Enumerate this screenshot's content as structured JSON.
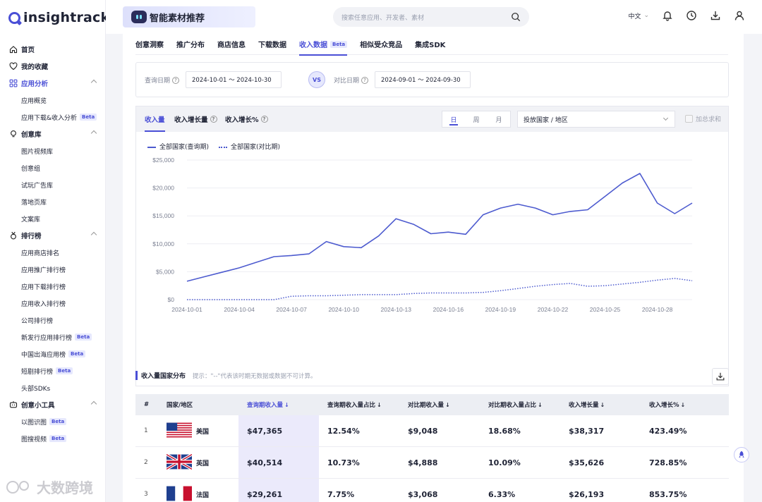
{
  "brand": {
    "name": "insightrackr",
    "accent": "#4a4fd6"
  },
  "header": {
    "banner": "智能素材推荐",
    "search_placeholder": "搜索任意应用、开发者、素材",
    "lang": "中文"
  },
  "sidebar": {
    "items": [
      {
        "label": "首页",
        "icon": "home-icon",
        "type": "item"
      },
      {
        "label": "我的收藏",
        "icon": "heart-icon",
        "type": "item"
      },
      {
        "label": "应用分析",
        "icon": "grid-icon",
        "type": "group",
        "active": true
      },
      {
        "label": "应用概览",
        "type": "sub"
      },
      {
        "label": "应用下载&收入分析",
        "type": "sub",
        "beta": "Beta"
      },
      {
        "label": "创意库",
        "icon": "bulb-icon",
        "type": "group"
      },
      {
        "label": "图片视频库",
        "type": "sub"
      },
      {
        "label": "创意组",
        "type": "sub"
      },
      {
        "label": "试玩广告库",
        "type": "sub"
      },
      {
        "label": "落地页库",
        "type": "sub"
      },
      {
        "label": "文案库",
        "type": "sub"
      },
      {
        "label": "排行榜",
        "icon": "medal-icon",
        "type": "group"
      },
      {
        "label": "应用商店排名",
        "type": "sub"
      },
      {
        "label": "应用推广排行榜",
        "type": "sub"
      },
      {
        "label": "应用下载排行榜",
        "type": "sub"
      },
      {
        "label": "应用收入排行榜",
        "type": "sub"
      },
      {
        "label": "公司排行榜",
        "type": "sub"
      },
      {
        "label": "新发行应用排行榜",
        "type": "sub",
        "beta": "Beta"
      },
      {
        "label": "中国出海应用榜",
        "type": "sub",
        "beta": "Beta"
      },
      {
        "label": "短剧排行榜",
        "type": "sub",
        "beta": "Beta"
      },
      {
        "label": "头部SDKs",
        "type": "sub"
      },
      {
        "label": "创意小工具",
        "icon": "robot-icon",
        "type": "group"
      },
      {
        "label": "以图识图",
        "type": "sub",
        "beta": "Beta"
      },
      {
        "label": "图搜视频",
        "type": "sub",
        "beta": "Beta"
      }
    ]
  },
  "tabs": [
    {
      "label": "创意洞察"
    },
    {
      "label": "推广分布"
    },
    {
      "label": "商店信息"
    },
    {
      "label": "下载数据"
    },
    {
      "label": "收入数据",
      "beta": "Beta",
      "active": true
    },
    {
      "label": "相似受众竞品"
    },
    {
      "label": "集成SDK"
    }
  ],
  "dates": {
    "query_label": "查询日期",
    "query_value": "2024-10-01 ～ 2024-10-30",
    "vs": "VS",
    "compare_label": "对比日期",
    "compare_value": "2024-09-01 ～ 2024-09-30"
  },
  "chart_tabs": {
    "t1": "收入量",
    "t2": "收入增长量",
    "t3": "收入增长%",
    "day": "日",
    "week": "周",
    "month": "月",
    "country_select": "投放国家 / 地区",
    "sum": "加总求和"
  },
  "chart_data": {
    "type": "line",
    "x": [
      "2024-10-01",
      "2024-10-02",
      "2024-10-03",
      "2024-10-04",
      "2024-10-05",
      "2024-10-06",
      "2024-10-07",
      "2024-10-08",
      "2024-10-09",
      "2024-10-10",
      "2024-10-11",
      "2024-10-12",
      "2024-10-13",
      "2024-10-14",
      "2024-10-15",
      "2024-10-16",
      "2024-10-17",
      "2024-10-18",
      "2024-10-19",
      "2024-10-20",
      "2024-10-21",
      "2024-10-22",
      "2024-10-23",
      "2024-10-24",
      "2024-10-25",
      "2024-10-26",
      "2024-10-27",
      "2024-10-28",
      "2024-10-29",
      "2024-10-30"
    ],
    "x_tick_labels": [
      "2024-10-01",
      "2024-10-04",
      "2024-10-07",
      "2024-10-10",
      "2024-10-13",
      "2024-10-16",
      "2024-10-19",
      "2024-10-22",
      "2024-10-25",
      "2024-10-28"
    ],
    "y_ticks": [
      "$25,000",
      "$20,000",
      "$15,000",
      "$10,000",
      "$5,000",
      "$0"
    ],
    "ylim": [
      0,
      25000
    ],
    "series": [
      {
        "name": "全部国家(查询期)",
        "style": "solid",
        "values": [
          3300,
          4100,
          4900,
          5700,
          6700,
          7700,
          7900,
          8200,
          10400,
          9500,
          9300,
          11400,
          14500,
          13500,
          11800,
          12100,
          11700,
          15200,
          16400,
          17100,
          16400,
          15200,
          15800,
          16100,
          18500,
          20900,
          22600,
          17300,
          15400,
          17300
        ]
      },
      {
        "name": "全部国家(对比期)",
        "style": "dotted",
        "values": [
          0,
          0,
          0,
          0,
          0,
          0,
          600,
          700,
          700,
          800,
          900,
          900,
          900,
          1100,
          1200,
          1200,
          1200,
          1300,
          1600,
          2000,
          2400,
          2700,
          2900,
          2400,
          2500,
          2800,
          3100,
          3500,
          3800,
          3400
        ]
      }
    ],
    "color": "#4d5bcf"
  },
  "distribution": {
    "title": "收入量国家分布",
    "hint": "提示：\"--\"代表该时期无数据或数据不可计算。"
  },
  "table": {
    "headers": [
      "#",
      "国家/地区",
      "查询期收入量",
      "查询期收入量占比",
      "对比期收入量",
      "对比期收入量占比",
      "收入增长量",
      "收入增长%"
    ],
    "rows": [
      {
        "rank": "1",
        "flag": "us",
        "country": "美国",
        "q": "$47,365",
        "qp": "12.54%",
        "c": "$9,048",
        "cp": "18.68%",
        "g": "$38,317",
        "gp": "423.49%"
      },
      {
        "rank": "2",
        "flag": "gb",
        "country": "英国",
        "q": "$40,514",
        "qp": "10.73%",
        "c": "$4,888",
        "cp": "10.09%",
        "g": "$35,626",
        "gp": "728.85%"
      },
      {
        "rank": "3",
        "flag": "fr",
        "country": "法国",
        "q": "$29,261",
        "qp": "7.75%",
        "c": "$3,068",
        "cp": "6.33%",
        "g": "$26,193",
        "gp": "853.75%"
      }
    ]
  },
  "watermark": "大数跨境"
}
